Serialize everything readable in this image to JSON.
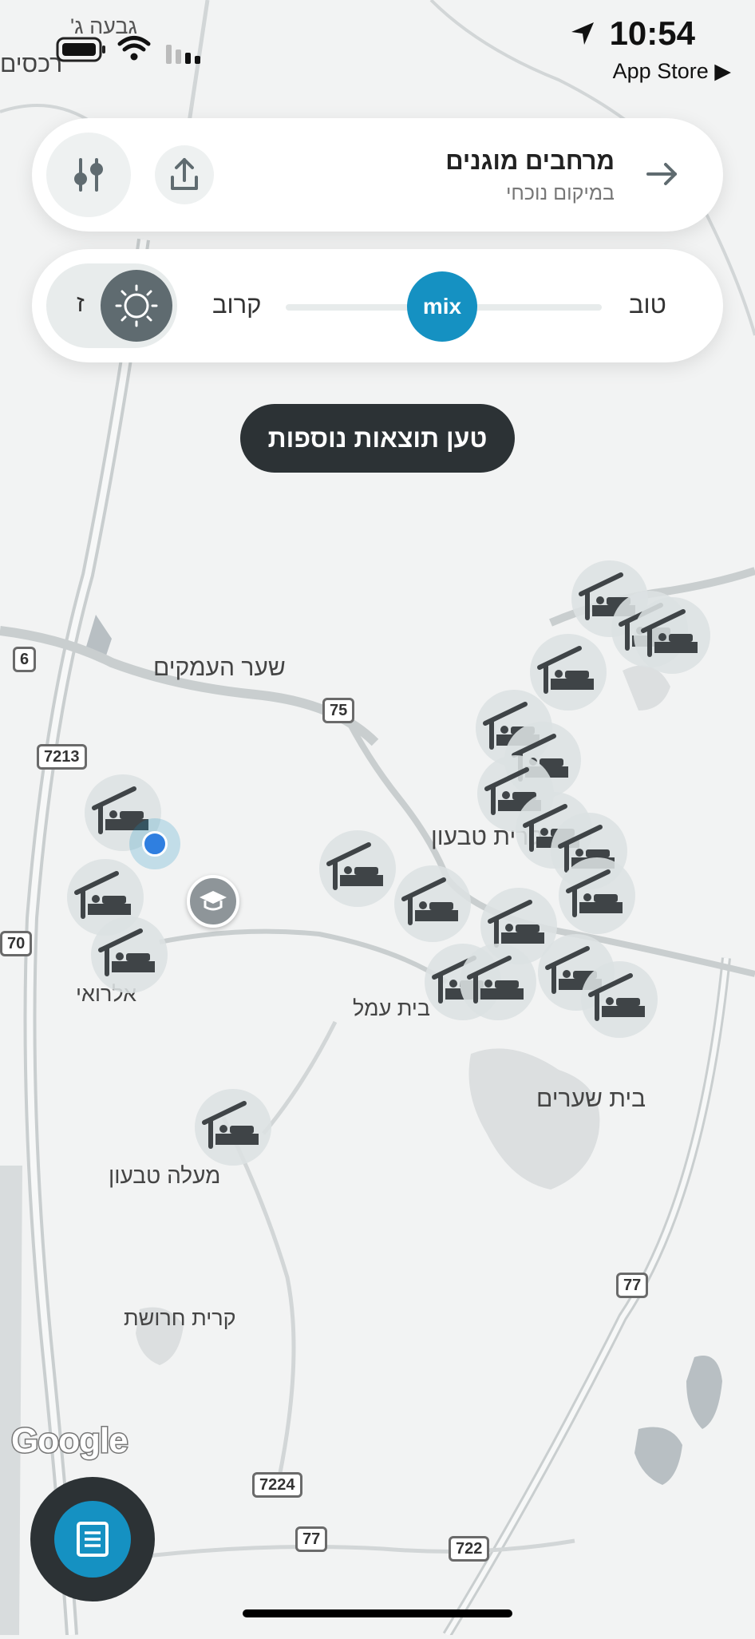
{
  "status_bar": {
    "time": "10:54",
    "back_app": "App Store ▶",
    "corner_place": "גבעה ג'",
    "corner_place2": "רכסים"
  },
  "header_card": {
    "title": "מרחבים מוגנים",
    "subtitle": "במיקום נוכחי"
  },
  "slider": {
    "left_label": "קרוב",
    "right_label": "טוב",
    "knob_label": "mix",
    "toggle_letter": "ז"
  },
  "load_more_label": "טען תוצאות נוספות",
  "places": {
    "shaar_haamakim": "שער העמקים",
    "kiryat_tivon": "קרית טבעון",
    "beit_shearim": "בית שערים",
    "maale_tivon": "מעלה טבעון",
    "kiryat_harosht": "קרית חרושת",
    "alroi": "אלרואי",
    "beit_amal": "בית עמל"
  },
  "roads": {
    "r6": "6",
    "r7213": "7213",
    "r75": "75",
    "r70": "70",
    "r77a": "77",
    "r77b": "77",
    "r7224": "7224",
    "r722": "722"
  },
  "map_brand": "Google",
  "colors": {
    "accent": "#1591c2",
    "dark": "#2c3235",
    "map_bg": "#f2f3f3"
  },
  "icons": [
    "navigation-arrow-icon",
    "battery-icon",
    "wifi-icon",
    "signal-icon",
    "arrow-right-icon",
    "share-icon",
    "filter-sliders-icon",
    "sun-icon",
    "bed-lodge-icon",
    "graduation-cap-icon",
    "location-dot-icon",
    "list-icon"
  ]
}
